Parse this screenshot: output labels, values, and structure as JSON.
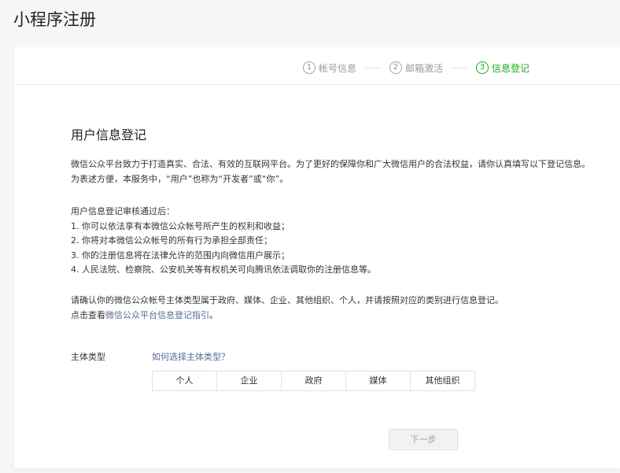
{
  "page": {
    "title": "小程序注册"
  },
  "steps": [
    {
      "num": "1",
      "label": "帐号信息",
      "state": "done"
    },
    {
      "num": "2",
      "label": "邮箱激活",
      "state": "done"
    },
    {
      "num": "3",
      "label": "信息登记",
      "state": "active"
    }
  ],
  "section": {
    "title": "用户信息登记"
  },
  "intro": {
    "line1": "微信公众平台致力于打造真实、合法、有效的互联网平台。为了更好的保障你和广大微信用户的合法权益，请你认真填写以下登记信息。",
    "line2": "为表述方便，本服务中，“用户”也称为“开发者”或“你”。"
  },
  "rules": {
    "heading": "用户信息登记审核通过后：",
    "items": [
      "1. 你可以依法享有本微信公众帐号所产生的权利和收益；",
      "2. 你将对本微信公众帐号的所有行为承担全部责任；",
      "3. 你的注册信息将在法律允许的范围内向微信用户展示；",
      "4. 人民法院、检察院、公安机关等有权机关可向腾讯依法调取你的注册信息等。"
    ]
  },
  "confirm": {
    "line1": "请确认你的微信公众帐号主体类型属于政府、媒体、企业、其他组织、个人，并请按照对应的类别进行信息登记。",
    "line2_prefix": "点击查看",
    "line2_link": "微信公众平台信息登记指引",
    "line2_suffix": "。"
  },
  "subject_type": {
    "label": "主体类型",
    "help_link": "如何选择主体类型？",
    "options": [
      "个人",
      "企业",
      "政府",
      "媒体",
      "其他组织"
    ]
  },
  "actions": {
    "next_label": "下一步",
    "next_disabled": true
  },
  "colors": {
    "accent_green": "#1aad19",
    "link_blue": "#576b95",
    "background": "#f5f6f7"
  }
}
